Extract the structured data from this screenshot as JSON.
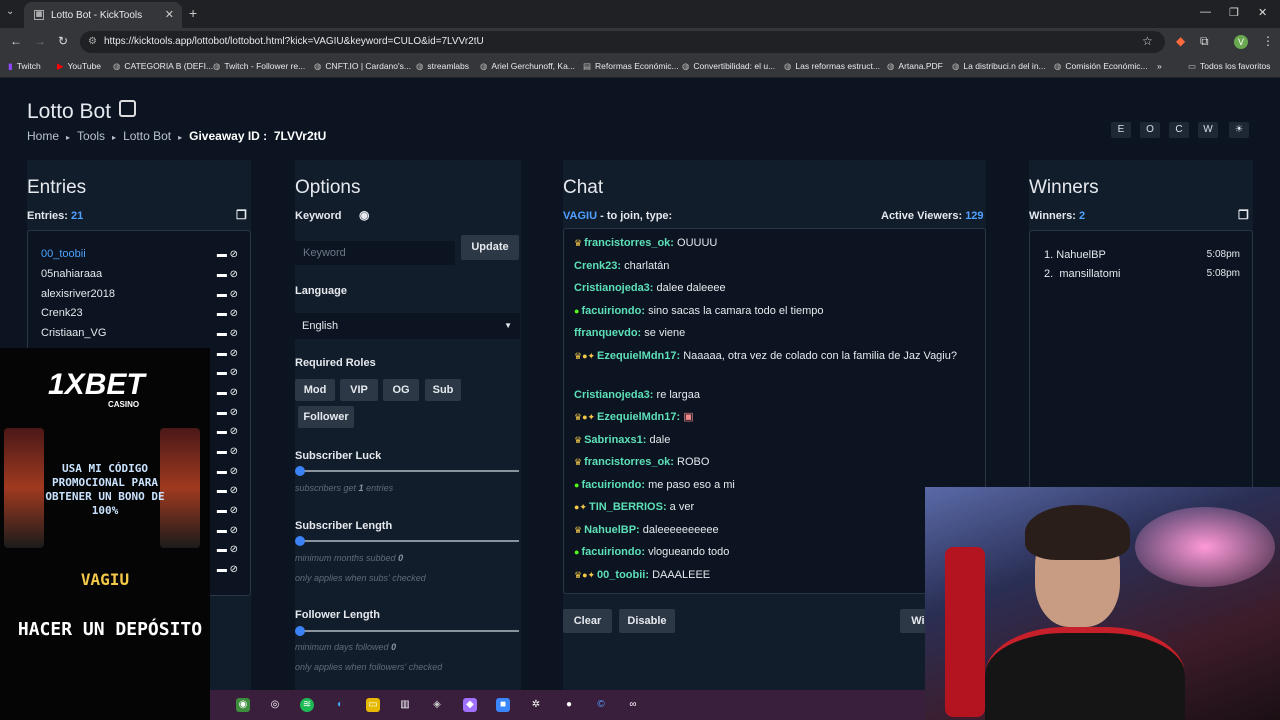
{
  "browser": {
    "tab_title": "Lotto Bot - KickTools",
    "url": "https://kicktools.app/lottobot/lottobot.html?kick=VAGIU&keyword=CULO&id=7LVVr2tU",
    "profile_initial": "V",
    "bookmarks": [
      "Twitch",
      "YouTube",
      "CATEGORIA B (DEFI...",
      "Twitch - Follower re...",
      "CNFT.IO | Cardano's...",
      "streamlabs",
      "Ariel Gerchunoff, Ka...",
      "Reformas Económic...",
      "Convertibilidad: el u...",
      "Las reformas estruct...",
      "Artana.PDF",
      "La distribuci.n del in...",
      "Comisión Económic...",
      "Todos los favoritos"
    ]
  },
  "header": {
    "title": "Lotto Bot",
    "breadcrumb": [
      "Home",
      "Tools",
      "Lotto Bot"
    ],
    "giveaway_label": "Giveaway ID :",
    "giveaway_id": "7LVVr2tU",
    "theme_buttons": [
      "E",
      "O",
      "C",
      "W",
      "☀"
    ]
  },
  "entries": {
    "title": "Entries",
    "count_label": "Entries:",
    "count": "21",
    "items": [
      "00_toobii",
      "05nahiaraaa",
      "alexisriver2018",
      "Crenk23",
      "Cristiaan_VG"
    ]
  },
  "options": {
    "title": "Options",
    "keyword_label": "Keyword",
    "keyword_placeholder": "Keyword",
    "update_button": "Update",
    "language_label": "Language",
    "language_value": "English",
    "roles_label": "Required Roles",
    "roles": [
      "Mod",
      "VIP",
      "OG",
      "Sub",
      "Follower"
    ],
    "sub_luck_label": "Subscriber Luck",
    "sub_luck_hint_pre": "subscribers get",
    "sub_luck_value": "1",
    "sub_luck_hint_post": "entries",
    "sub_length_label": "Subscriber Length",
    "sub_length_hint": "minimum months subbed",
    "sub_length_value": "0",
    "sub_length_note": "only applies when subs' checked",
    "follow_length_label": "Follower Length",
    "follow_length_hint": "minimum days followed",
    "follow_length_value": "0",
    "follow_length_note": "only applies when followers' checked"
  },
  "chat": {
    "title": "Chat",
    "channel": "VAGIU",
    "join_text": "- to join, type:",
    "viewers_label": "Active Viewers:",
    "viewers": "129",
    "messages": [
      {
        "badges": "♛",
        "user": "francistorres_ok:",
        "text": "OUUUU"
      },
      {
        "badges": "",
        "user": "Crenk23:",
        "text": "charlatán"
      },
      {
        "badges": "",
        "user": "Cristianojeda3:",
        "text": "dalee daleeee"
      },
      {
        "badges": "●",
        "user": "facuiriondo:",
        "text": "sino sacas la camara todo el tiempo"
      },
      {
        "badges": "",
        "user": "ffranquevdo:",
        "text": "se viene"
      },
      {
        "badges": "♛●✦",
        "user": "EzequielMdn17:",
        "text": "Naaaaa, otra vez de colado con la familia de Jaz Vagiu?"
      },
      {
        "badges": "",
        "user": "Cristianojeda3:",
        "text": "re largaa"
      },
      {
        "badges": "♛●✦",
        "user": "EzequielMdn17:",
        "text": "▣"
      },
      {
        "badges": "♛",
        "user": "Sabrinaxs1:",
        "text": "dale"
      },
      {
        "badges": "♛",
        "user": "francistorres_ok:",
        "text": "ROBO"
      },
      {
        "badges": "●",
        "user": "facuiriondo:",
        "text": "me paso eso a mi"
      },
      {
        "badges": "●✦",
        "user": "TIN_BERRIOS:",
        "text": "a ver"
      },
      {
        "badges": "♛",
        "user": "NahuelBP:",
        "text": "daleeeeeeeeee"
      },
      {
        "badges": "●",
        "user": "facuiriondo:",
        "text": "vlogueando todo"
      },
      {
        "badges": "♛●✦",
        "user": "00_toobii:",
        "text": "DAAALEEE"
      }
    ],
    "clear_button": "Clear",
    "disable_button": "Disable",
    "win_button": "Wir"
  },
  "winners": {
    "title": "Winners",
    "count_label": "Winners:",
    "count": "2",
    "items": [
      {
        "num": "1.",
        "name": "NahuelBP",
        "time": "5:08pm"
      },
      {
        "num": "2.",
        "name": "mansillatomi",
        "time": "5:08pm"
      }
    ]
  },
  "ad": {
    "logo": "1XBET",
    "sub": "CASINO",
    "promo": "USA MI CÓDIGO PROMOCIONAL PARA OBTENER UN BONO DE 100%",
    "code": "VAGIU",
    "cta": "HACER UN DEPÓSITO"
  },
  "colors": {
    "accent": "#4ea1ff",
    "chat_user": "#5de0b8",
    "background": "#0b1420",
    "card": "#121d2b"
  }
}
